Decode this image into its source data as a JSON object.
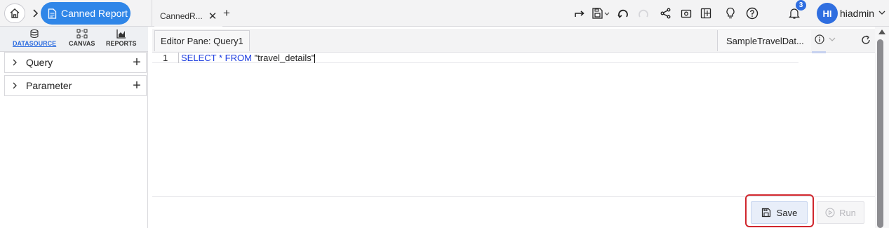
{
  "header": {
    "breadcrumb": {
      "current_label": "Canned Report"
    },
    "tab": {
      "label": "CannedR...",
      "close_glyph": "✕",
      "add_glyph": "+"
    },
    "toolbar_icons": [
      "redo-arrow-icon",
      "save-dropdown-icon",
      "undo-icon",
      "redo-icon",
      "share-icon",
      "screenshot-icon",
      "layout-icon",
      "lightbulb-icon",
      "help-icon",
      "bell-icon"
    ],
    "notification_count": "3",
    "user": {
      "initials": "HI",
      "name": "hiadmin"
    }
  },
  "left_panel": {
    "tabs": [
      {
        "label": "DATASOURCE",
        "icon": "database-icon",
        "active": true
      },
      {
        "label": "CANVAS",
        "icon": "canvas-icon",
        "active": false
      },
      {
        "label": "REPORTS",
        "icon": "reports-chart-icon",
        "active": false
      }
    ],
    "tree": [
      {
        "label": "Query",
        "add_glyph": "+"
      },
      {
        "label": "Parameter",
        "add_glyph": "+"
      }
    ]
  },
  "editor": {
    "pane_title": "Editor Pane: Query1",
    "datasource": "SampleTravelDat...",
    "line_number": "1",
    "code": {
      "kw1": "SELECT",
      "star": " * ",
      "kw2": "FROM",
      "str": " \"travel_details\""
    },
    "save_label": "Save",
    "run_label": "Run"
  },
  "colors": {
    "accent": "#2f86e8",
    "avatar": "#2f6ee0",
    "keyword": "#1f3fe0",
    "highlight": "#d0262d"
  }
}
